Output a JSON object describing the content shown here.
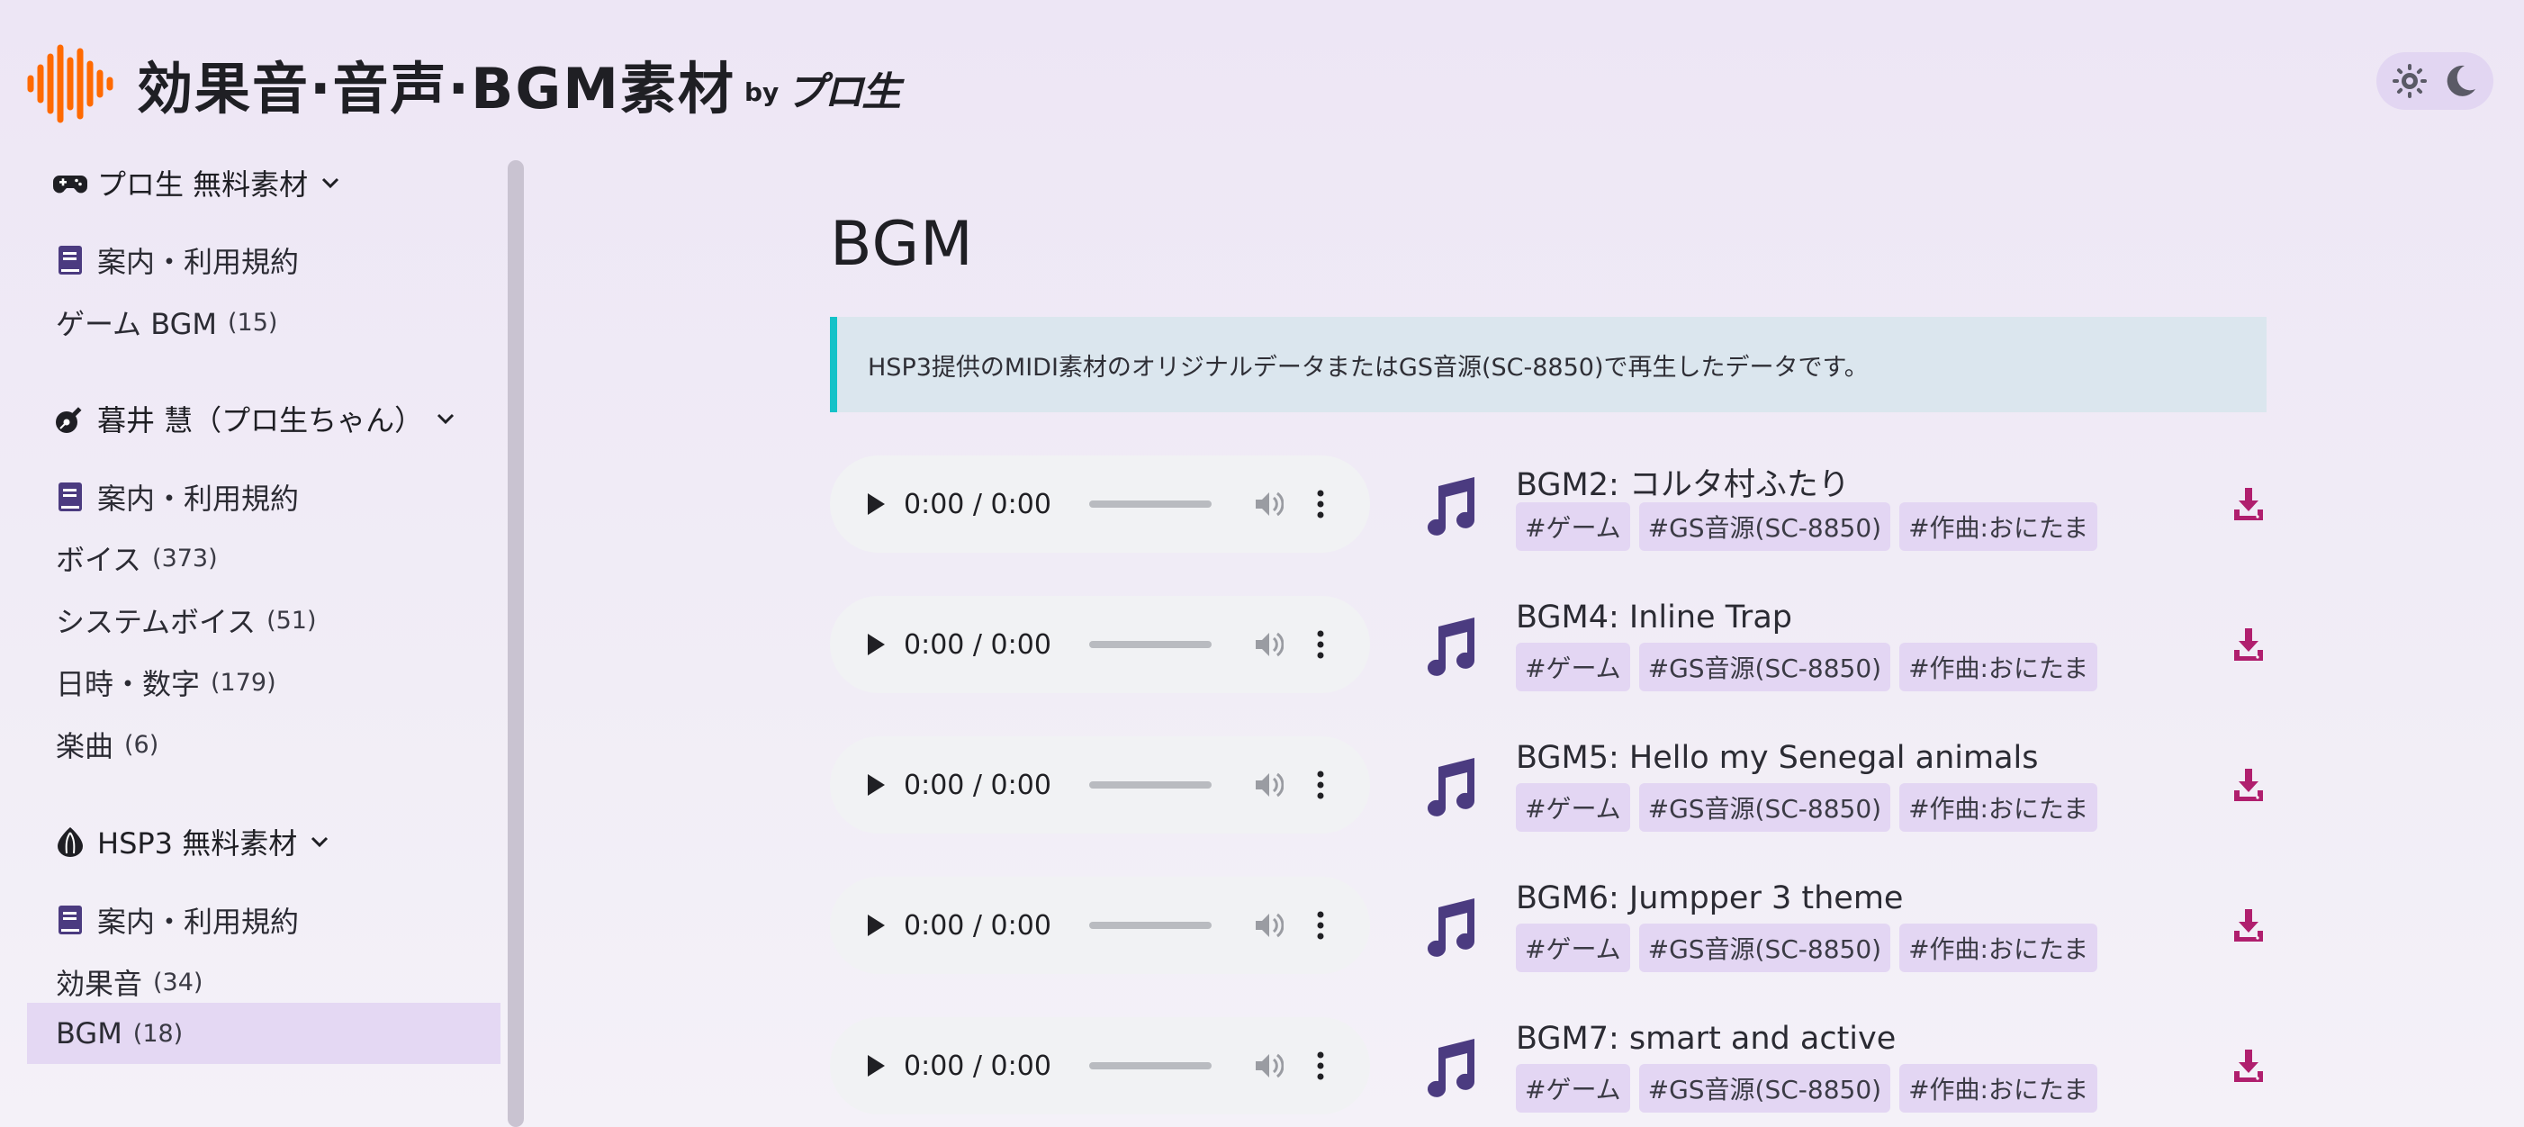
{
  "header": {
    "site_title": "効果音·音声·BGM素材",
    "by_label": "by",
    "brand": "プロ生",
    "theme_toggle": {
      "light_icon": "sun-icon",
      "dark_icon": "moon-icon"
    }
  },
  "colors": {
    "accent_purple": "#4b3b80",
    "download_magenta": "#b01f6e",
    "logo_orange": "#ff6a00",
    "info_border": "#14c2c8",
    "active_bg": "#e4d8f3"
  },
  "sidebar": {
    "groups": [
      {
        "title": "プロ生 無料素材",
        "icon": "gamepad-icon",
        "items": [
          {
            "label": "案内・利用規約",
            "icon": "book-icon",
            "count": ""
          },
          {
            "label": "ゲーム BGM",
            "count": "(15)"
          }
        ]
      },
      {
        "title": "暮井 慧（プロ生ちゃん）",
        "icon": "guitar-icon",
        "items": [
          {
            "label": "案内・利用規約",
            "icon": "book-icon",
            "count": ""
          },
          {
            "label": "ボイス",
            "count": "(373)"
          },
          {
            "label": "システムボイス",
            "count": "(51)"
          },
          {
            "label": "日時・数字",
            "count": "(179)"
          },
          {
            "label": "楽曲",
            "count": "(6)"
          }
        ]
      },
      {
        "title": "HSP3 無料素材",
        "icon": "onion-icon",
        "items": [
          {
            "label": "案内・利用規約",
            "icon": "book-icon",
            "count": ""
          },
          {
            "label": "効果音",
            "count": "(34)"
          },
          {
            "label": "BGM",
            "count": "(18)",
            "active": true
          }
        ]
      }
    ]
  },
  "main": {
    "title": "BGM",
    "info": "HSP3提供のMIDI素材のオリジナルデータまたはGS音源(SC-8850)で再生したデータです。",
    "player_time": "0:00 / 0:00",
    "tracks": [
      {
        "title": "BGM2: コルタ村ふたり",
        "tags": [
          "#ゲーム",
          "#GS音源(SC-8850)",
          "#作曲:おにたま"
        ]
      },
      {
        "title": "BGM4: Inline Trap",
        "tags": [
          "#ゲーム",
          "#GS音源(SC-8850)",
          "#作曲:おにたま"
        ]
      },
      {
        "title": "BGM5: Hello my Senegal animals",
        "tags": [
          "#ゲーム",
          "#GS音源(SC-8850)",
          "#作曲:おにたま"
        ]
      },
      {
        "title": "BGM6: Jumpper 3 theme",
        "tags": [
          "#ゲーム",
          "#GS音源(SC-8850)",
          "#作曲:おにたま"
        ]
      },
      {
        "title": "BGM7: smart and active",
        "tags": [
          "#ゲーム",
          "#GS音源(SC-8850)",
          "#作曲:おにたま"
        ]
      }
    ]
  }
}
